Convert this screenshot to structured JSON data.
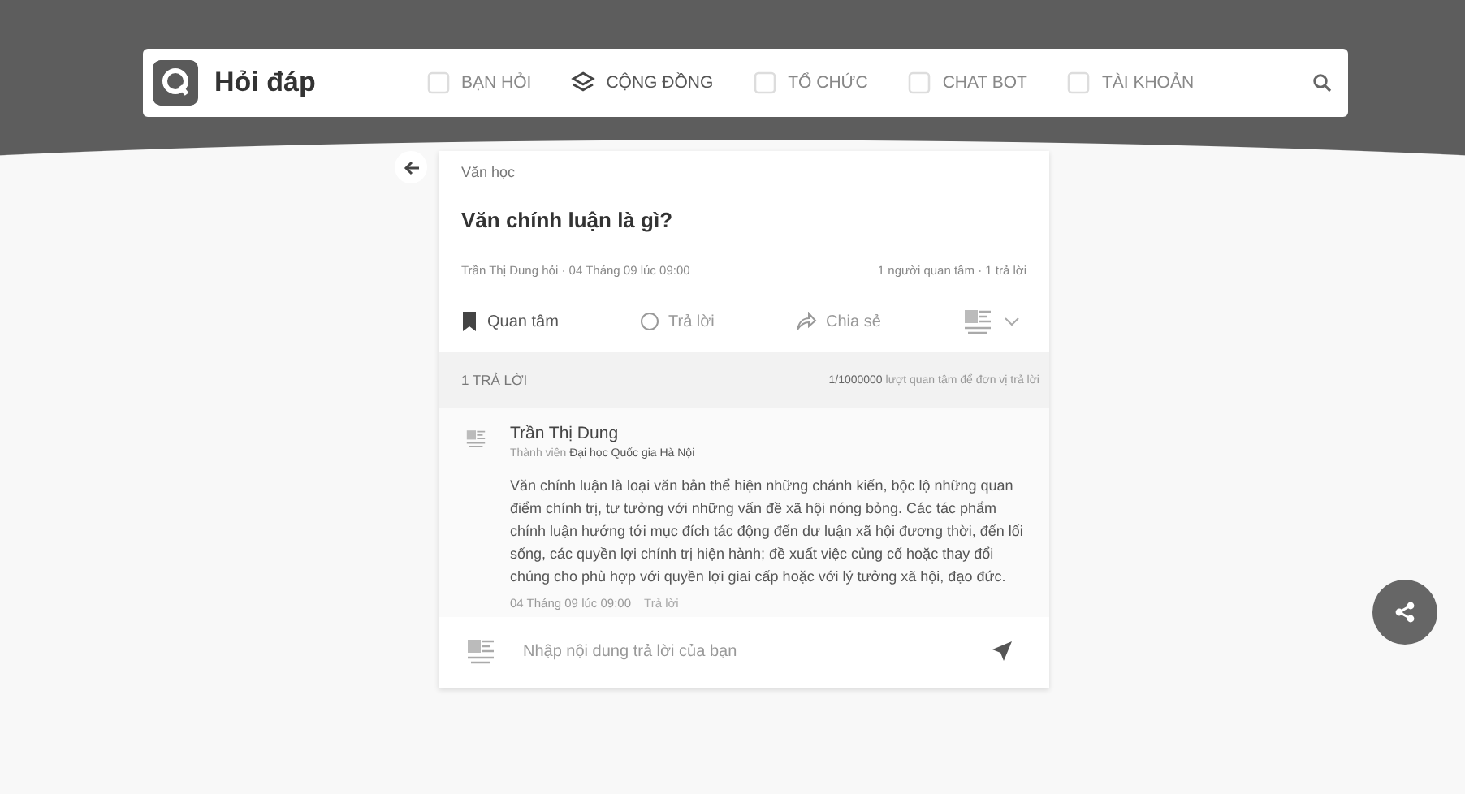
{
  "header": {
    "title": "Hỏi đáp",
    "nav": [
      {
        "label": "BẠN HỎI",
        "selected": false
      },
      {
        "label": "CỘNG ĐỒNG",
        "selected": true
      },
      {
        "label": "TỔ CHỨC",
        "selected": false
      },
      {
        "label": "CHAT BOT",
        "selected": false
      },
      {
        "label": "TÀI KHOẢN",
        "selected": false
      }
    ]
  },
  "question": {
    "category": "Văn học",
    "title": "Văn chính luận là gì?",
    "meta": "Trần Thị Dung hỏi · 04 Tháng 09 lúc 09:00",
    "stats": "1 người quan tâm · 1 trả lời",
    "actions": [
      {
        "kind": "follow",
        "label": "Quan tâm"
      },
      {
        "kind": "reply",
        "label": "Trả lời"
      },
      {
        "kind": "share",
        "label": "Chia sẻ"
      }
    ]
  },
  "answers": {
    "heading": "1 TRẢ LỜI",
    "quota_count": "1/1000000",
    "quota_text": "lượt quan tâm để đơn vị trả lời",
    "items": [
      {
        "author": "Trần Thị Dung",
        "role": "Thành viên",
        "org": "Đại học Quốc gia Hà Nội",
        "body": "Văn chính luận là loại văn bản thể hiện những chánh kiến, bộc lộ những quan điểm chính trị, tư tưởng với những vấn đề xã hội nóng bỏng. Các tác phẩm chính luận hướng tới mục đích tác động đến dư luận xã hội đương thời, đến lối sống, các quyền lợi chính trị hiện hành; đề xuất việc củng cố hoặc thay đổi chúng cho phù hợp với quyền lợi giai cấp hoặc với lý tưởng xã hội, đạo đức.",
        "time": "04 Tháng 09 lúc 09:00",
        "reply": "Trả lời"
      }
    ]
  },
  "composer": {
    "placeholder": "Nhập nội dung trả lời của bạn"
  }
}
